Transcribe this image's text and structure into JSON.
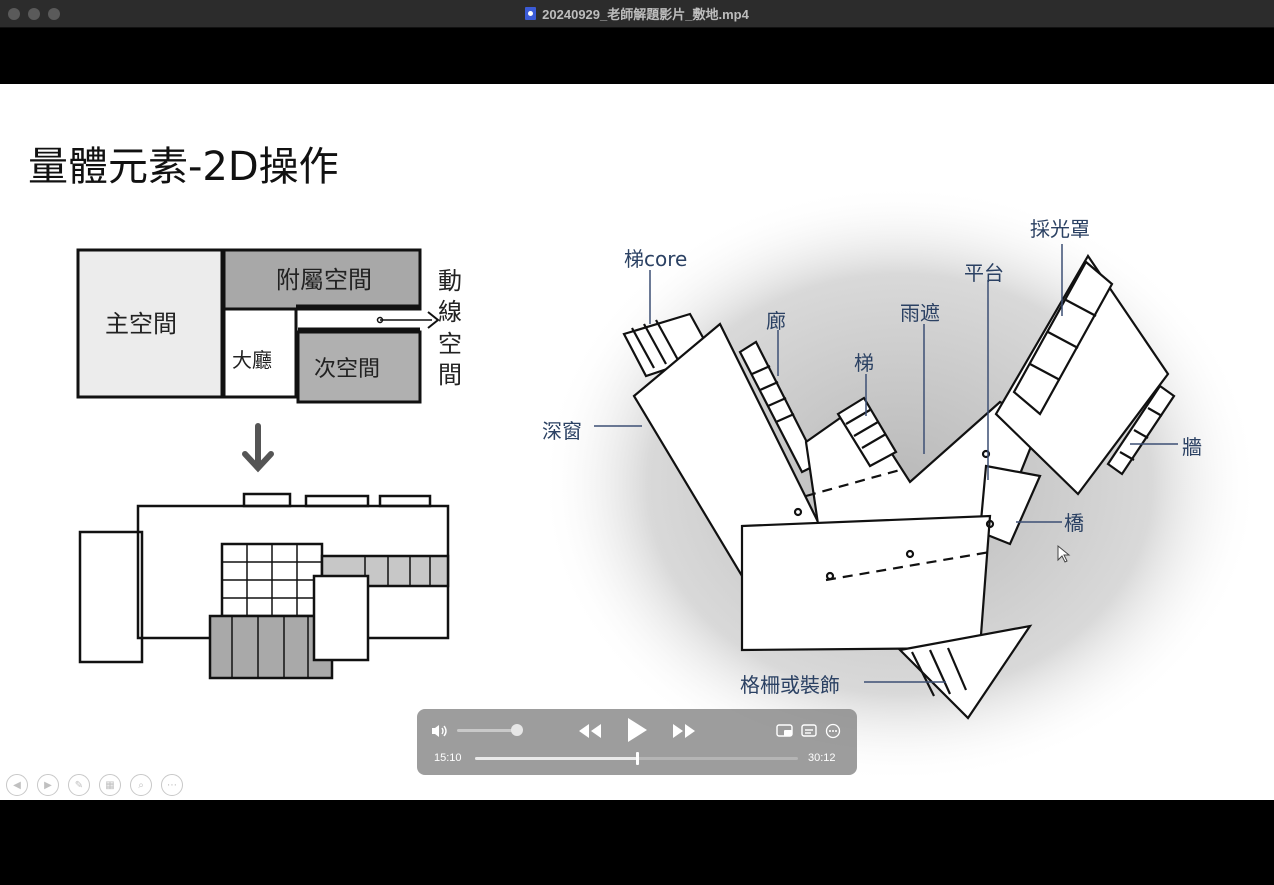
{
  "window": {
    "title": "20240929_老師解題影片_敷地.mp4"
  },
  "slide": {
    "title": "量體元素-2D操作",
    "diagram_left": {
      "main": "主空間",
      "aux": "附屬空間",
      "lobby": "大廳",
      "secondary": "次空間",
      "circulation": [
        "動",
        "線",
        "空",
        "間"
      ]
    },
    "plan_labels": {
      "stair_core": "梯core",
      "corridor": "廊",
      "stair": "梯",
      "canopy": "雨遮",
      "platform": "平台",
      "skylight": "採光罩",
      "deep_window": "深窗",
      "wall": "牆",
      "bridge": "橋",
      "grille": "格柵或裝飾"
    }
  },
  "player": {
    "current_time": "15:10",
    "duration": "30:12",
    "progress": 0.502,
    "volume": 0.85,
    "colors": {
      "panel": "#8c8c8c",
      "accent": "#ffffff",
      "label": "#2b4163"
    }
  }
}
